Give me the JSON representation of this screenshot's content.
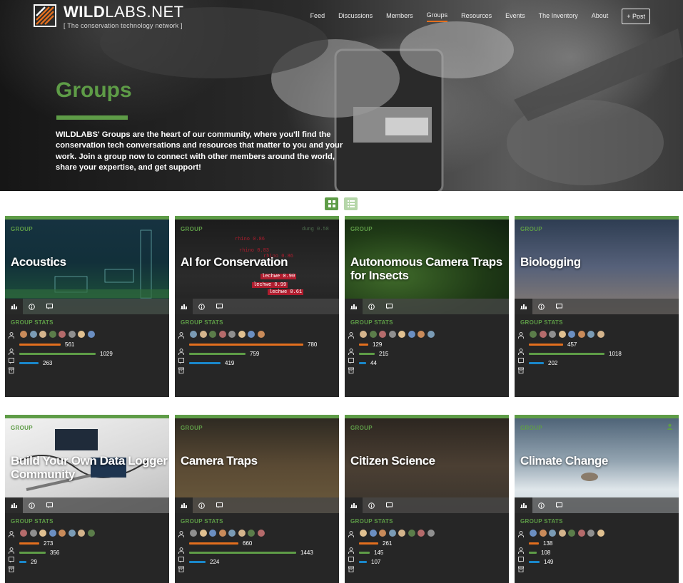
{
  "site": {
    "name_bold": "WILD",
    "name_rest": "LABS.NET",
    "tagline": "[ The conservation technology network ]"
  },
  "nav": {
    "items": [
      "Feed",
      "Discussions",
      "Members",
      "Groups",
      "Resources",
      "Events",
      "The Inventory",
      "About"
    ],
    "active": "Groups",
    "post_label": "+ Post"
  },
  "hero": {
    "title": "Groups",
    "description": "WILDLABS' Groups are the heart of our community, where you'll find the conservation tech conversations and resources that matter to you and your work. Join a group now to connect with other members around the world, share your expertise, and get support!"
  },
  "colors": {
    "accent": "#5e9c47",
    "members_bar": "#e36f1e",
    "discussions_bar": "#5e9c47",
    "resources_bar": "#1a87c9"
  },
  "card_labels": {
    "group": "GROUP",
    "stats": "GROUP STATS"
  },
  "groups": [
    {
      "title": "Acoustics",
      "members": 561,
      "discussions": 1029,
      "resources": 263
    },
    {
      "title": "AI for Conservation",
      "members": 780,
      "discussions": 759,
      "resources": 419
    },
    {
      "title": "Autonomous Camera Traps for Insects",
      "members": 129,
      "discussions": 215,
      "resources": 44
    },
    {
      "title": "Biologging",
      "members": 457,
      "discussions": 1018,
      "resources": 202
    },
    {
      "title": "Build Your Own Data Logger Community",
      "members": 273,
      "discussions": 356,
      "resources": 29
    },
    {
      "title": "Camera Traps",
      "members": 660,
      "discussions": 1443,
      "resources": 224
    },
    {
      "title": "Citizen Science",
      "members": 261,
      "discussions": 145,
      "resources": 107
    },
    {
      "title": "Climate Change",
      "members": 138,
      "discussions": 108,
      "resources": 149
    }
  ],
  "image_text": {
    "ai_tags": [
      "rhino 0.86",
      "rhino 0.83",
      "rhino 0.86",
      "lechwe 0.90",
      "lechwe 0.99",
      "lechwe 0.61",
      "dung 0.58"
    ]
  },
  "icons": {
    "view_grid": "grid-view-icon",
    "view_list": "list-view-icon",
    "tool_stats": "bar-chart-icon",
    "tool_info": "info-icon",
    "tool_discuss": "comment-icon",
    "members": "user-icon",
    "discussions": "chat-icon",
    "resources": "archive-icon"
  }
}
